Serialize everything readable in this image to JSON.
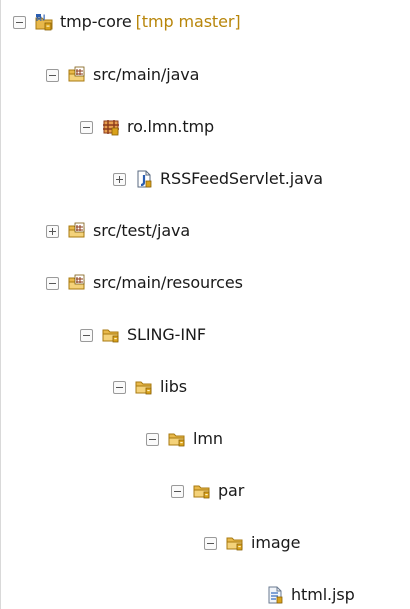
{
  "tree": {
    "project": {
      "label": "tmp-core",
      "decoration": "[tmp master]",
      "icon": "project-icon",
      "toggle": "minus"
    },
    "items": [
      {
        "label": "src/main/java",
        "icon": "source-folder-icon",
        "toggle": "minus"
      },
      {
        "label": "ro.lmn.tmp",
        "icon": "package-icon",
        "toggle": "minus"
      },
      {
        "label": "RSSFeedServlet.java",
        "icon": "java-file-icon",
        "toggle": "plus"
      },
      {
        "label": "src/test/java",
        "icon": "source-folder-icon",
        "toggle": "plus"
      },
      {
        "label": "src/main/resources",
        "icon": "source-folder-icon",
        "toggle": "minus"
      },
      {
        "label": "SLING-INF",
        "icon": "folder-icon",
        "toggle": "minus"
      },
      {
        "label": "libs",
        "icon": "folder-icon",
        "toggle": "minus"
      },
      {
        "label": "lmn",
        "icon": "folder-icon",
        "toggle": "minus"
      },
      {
        "label": "par",
        "icon": "folder-icon",
        "toggle": "minus"
      },
      {
        "label": "image",
        "icon": "folder-icon",
        "toggle": "minus"
      },
      {
        "label": "html.jsp",
        "icon": "jsp-file-icon",
        "toggle": "none"
      }
    ]
  },
  "colors": {
    "folder": "#e8b84a",
    "folder_dark": "#b8860b",
    "decoration": "#b8860b",
    "java_blue": "#2a5db0"
  }
}
